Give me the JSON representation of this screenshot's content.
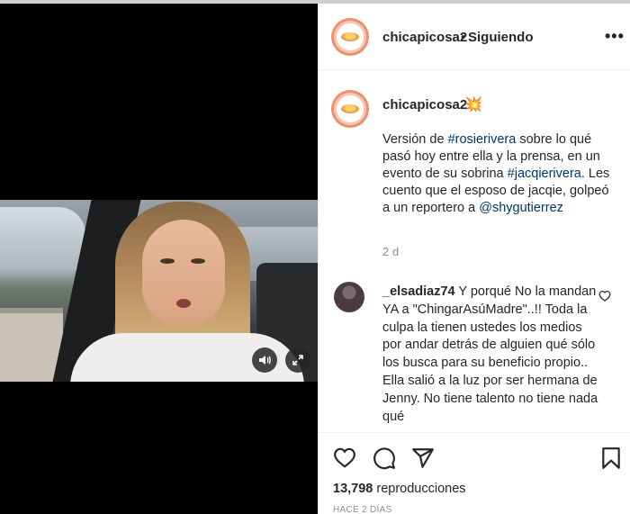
{
  "post": {
    "username": "chicapicosa2",
    "separator": "•",
    "follow_status": "Siguiendo",
    "more_icon": "•••"
  },
  "caption": {
    "username": "chicapicosa2",
    "emoji": "💥",
    "text_1": "Versión de ",
    "tag_1": "#rosierivera",
    "text_2": " sobre lo qué pasó hoy entre ella y la prensa, en un evento de su sobrina ",
    "tag_2": "#jacqierivera",
    "text_3": ". Les cuento que el esposo de jacqie, golpeó a un reportero a ",
    "tag_3": "@shygutierrez",
    "time": "2 d"
  },
  "comment": {
    "username": "_elsadiaz74",
    "text": " Y porqué No la mandan YA a \"ChingarAsúMadre\"..!! Toda la culpa la tienen ustedes los medios por andar detrás de alguien qué sólo los busca para su beneficio propio.. Ella salió a la luz por ser hermana de Jenny. No tiene talento no tiene nada qué"
  },
  "stats": {
    "views_count": "13,798",
    "views_label": "reproducciones",
    "ago": "HACE 2 DÍAS"
  },
  "icons": {
    "like": "heart-icon",
    "comment": "comment-icon",
    "share": "share-icon",
    "save": "bookmark-icon",
    "sound": "sound-icon",
    "fullscreen": "fullscreen-icon"
  }
}
